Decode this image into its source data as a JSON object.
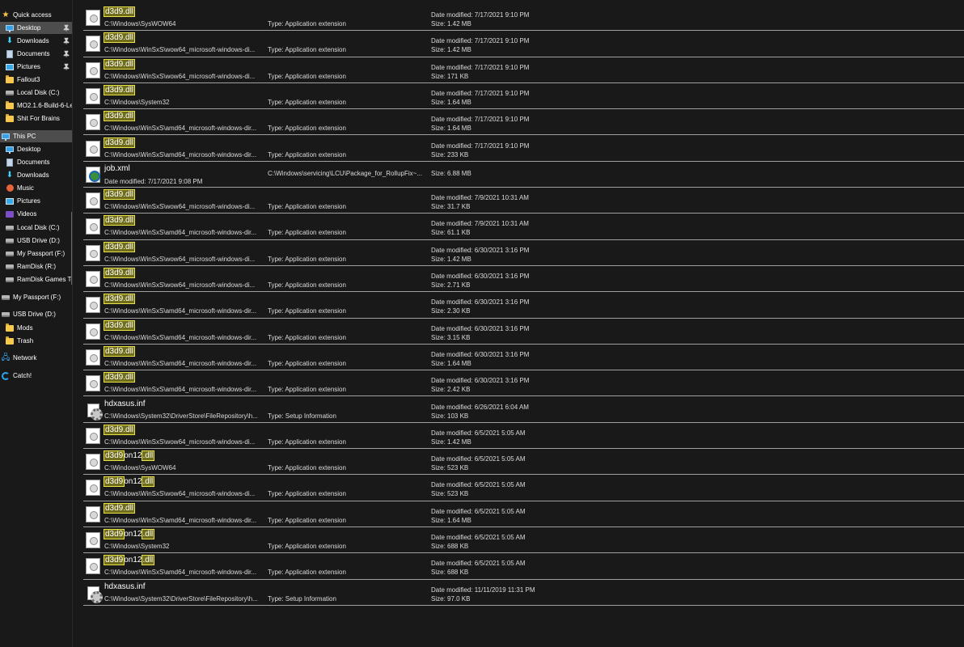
{
  "colors": {
    "background": "#191919",
    "selected": "#4d4d4d",
    "highlight_bg": "#706d1a",
    "highlight_border": "#e9e24a",
    "divider": "#a0a0a0"
  },
  "sidebar": {
    "quick_access": "Quick access",
    "desktop_pinned": "Desktop",
    "downloads_pinned": "Downloads",
    "documents_pinned": "Documents",
    "pictures_pinned": "Pictures",
    "fallout3": "Fallout3",
    "local_disk_c_quick": "Local Disk (C:)",
    "mo2": "MO2.1.6-Build-6-Le",
    "shit_for_brains": "Shit For Brains",
    "this_pc": "This PC",
    "pc_desktop": "Desktop",
    "pc_documents": "Documents",
    "pc_downloads": "Downloads",
    "pc_music": "Music",
    "pc_pictures": "Pictures",
    "pc_videos": "Videos",
    "pc_local_disk_c": "Local Disk (C:)",
    "pc_usb_drive_d": "USB Drive (D:)",
    "pc_my_passport_f": "My Passport (F:)",
    "pc_ramdisk_r": "RamDisk (R:)",
    "pc_ramdisk_games": "RamDisk Games To",
    "my_passport_f": "My Passport (F:)",
    "usb_drive_d": "USB Drive (D:)",
    "mods": "Mods",
    "trash": "Trash",
    "network": "Network",
    "catch": "Catch!"
  },
  "labels": {
    "type_prefix": "Type:",
    "date_prefix": "Date modified:",
    "size_prefix": "Size:"
  },
  "results": [
    {
      "pre": "",
      "hl1": "d3d9.dll",
      "mid": "",
      "hl2": "",
      "post": "",
      "path": "C:\\Windows\\SysWOW64",
      "type": "Type: Application extension",
      "date": "Date modified: 7/17/2021 9:10 PM",
      "size": "Size: 1.42 MB",
      "icon": "dll"
    },
    {
      "pre": "",
      "hl1": "d3d9.dll",
      "mid": "",
      "hl2": "",
      "post": "",
      "path": "C:\\Windows\\WinSxS\\wow64_microsoft-windows-di...",
      "type": "Type: Application extension",
      "date": "Date modified: 7/17/2021 9:10 PM",
      "size": "Size: 1.42 MB",
      "icon": "dll"
    },
    {
      "pre": "",
      "hl1": "d3d9.dll",
      "mid": "",
      "hl2": "",
      "post": "",
      "path": "C:\\Windows\\WinSxS\\wow64_microsoft-windows-di...",
      "type": "Type: Application extension",
      "date": "Date modified: 7/17/2021 9:10 PM",
      "size": "Size: 171 KB",
      "icon": "dll"
    },
    {
      "pre": "",
      "hl1": "d3d9.dll",
      "mid": "",
      "hl2": "",
      "post": "",
      "path": "C:\\Windows\\System32",
      "type": "Type: Application extension",
      "date": "Date modified: 7/17/2021 9:10 PM",
      "size": "Size: 1.64 MB",
      "icon": "dll"
    },
    {
      "pre": "",
      "hl1": "d3d9.dll",
      "mid": "",
      "hl2": "",
      "post": "",
      "path": "C:\\Windows\\WinSxS\\amd64_microsoft-windows-dir...",
      "type": "Type: Application extension",
      "date": "Date modified: 7/17/2021 9:10 PM",
      "size": "Size: 1.64 MB",
      "icon": "dll"
    },
    {
      "pre": "",
      "hl1": "d3d9.dll",
      "mid": "",
      "hl2": "",
      "post": "",
      "path": "C:\\Windows\\WinSxS\\amd64_microsoft-windows-dir...",
      "type": "Type: Application extension",
      "date": "Date modified: 7/17/2021 9:10 PM",
      "size": "Size: 233 KB",
      "icon": "dll"
    },
    {
      "pre": "job.xml",
      "hl1": "",
      "mid": "",
      "hl2": "",
      "post": "",
      "path": "",
      "under_date": "Date modified: 7/17/2021 9:08 PM",
      "type": "C:\\Windows\\servicing\\LCU\\Package_for_RollupFix~...",
      "date": "",
      "size": "Size: 6.88 MB",
      "icon": "xml",
      "layout": "mid"
    },
    {
      "pre": "",
      "hl1": "d3d9.dll",
      "mid": "",
      "hl2": "",
      "post": "",
      "path": "C:\\Windows\\WinSxS\\wow64_microsoft-windows-di...",
      "type": "Type: Application extension",
      "date": "Date modified: 7/9/2021 10:31 AM",
      "size": "Size: 31.7 KB",
      "icon": "dll"
    },
    {
      "pre": "",
      "hl1": "d3d9.dll",
      "mid": "",
      "hl2": "",
      "post": "",
      "path": "C:\\Windows\\WinSxS\\amd64_microsoft-windows-dir...",
      "type": "Type: Application extension",
      "date": "Date modified: 7/9/2021 10:31 AM",
      "size": "Size: 61.1 KB",
      "icon": "dll"
    },
    {
      "pre": "",
      "hl1": "d3d9.dll",
      "mid": "",
      "hl2": "",
      "post": "",
      "path": "C:\\Windows\\WinSxS\\wow64_microsoft-windows-di...",
      "type": "Type: Application extension",
      "date": "Date modified: 6/30/2021 3:16 PM",
      "size": "Size: 1.42 MB",
      "icon": "dll"
    },
    {
      "pre": "",
      "hl1": "d3d9.dll",
      "mid": "",
      "hl2": "",
      "post": "",
      "path": "C:\\Windows\\WinSxS\\wow64_microsoft-windows-di...",
      "type": "Type: Application extension",
      "date": "Date modified: 6/30/2021 3:16 PM",
      "size": "Size: 2.71 KB",
      "icon": "dll"
    },
    {
      "pre": "",
      "hl1": "d3d9.dll",
      "mid": "",
      "hl2": "",
      "post": "",
      "path": "C:\\Windows\\WinSxS\\amd64_microsoft-windows-dir...",
      "type": "Type: Application extension",
      "date": "Date modified: 6/30/2021 3:16 PM",
      "size": "Size: 2.30 KB",
      "icon": "dll"
    },
    {
      "pre": "",
      "hl1": "d3d9.dll",
      "mid": "",
      "hl2": "",
      "post": "",
      "path": "C:\\Windows\\WinSxS\\amd64_microsoft-windows-dir...",
      "type": "Type: Application extension",
      "date": "Date modified: 6/30/2021 3:16 PM",
      "size": "Size: 3.15 KB",
      "icon": "dll"
    },
    {
      "pre": "",
      "hl1": "d3d9.dll",
      "mid": "",
      "hl2": "",
      "post": "",
      "path": "C:\\Windows\\WinSxS\\amd64_microsoft-windows-dir...",
      "type": "Type: Application extension",
      "date": "Date modified: 6/30/2021 3:16 PM",
      "size": "Size: 1.64 MB",
      "icon": "dll"
    },
    {
      "pre": "",
      "hl1": "d3d9.dll",
      "mid": "",
      "hl2": "",
      "post": "",
      "path": "C:\\Windows\\WinSxS\\amd64_microsoft-windows-dir...",
      "type": "Type: Application extension",
      "date": "Date modified: 6/30/2021 3:16 PM",
      "size": "Size: 2.42 KB",
      "icon": "dll"
    },
    {
      "pre": "hdxasus.inf",
      "hl1": "",
      "mid": "",
      "hl2": "",
      "post": "",
      "path": "C:\\Windows\\System32\\DriverStore\\FileRepository\\h...",
      "type": "Type: Setup Information",
      "date": "Date modified: 6/26/2021 6:04 AM",
      "size": "Size: 103 KB",
      "icon": "inf"
    },
    {
      "pre": "",
      "hl1": "d3d9.dll",
      "mid": "",
      "hl2": "",
      "post": "",
      "path": "C:\\Windows\\WinSxS\\wow64_microsoft-windows-di...",
      "type": "Type: Application extension",
      "date": "Date modified: 6/5/2021 5:05 AM",
      "size": "Size: 1.42 MB",
      "icon": "dll"
    },
    {
      "pre": "",
      "hl1": "d3d9",
      "mid": "on12",
      "hl2": ".dll",
      "post": "",
      "path": "C:\\Windows\\SysWOW64",
      "type": "Type: Application extension",
      "date": "Date modified: 6/5/2021 5:05 AM",
      "size": "Size: 523 KB",
      "icon": "dll"
    },
    {
      "pre": "",
      "hl1": "d3d9",
      "mid": "on12",
      "hl2": ".dll",
      "post": "",
      "path": "C:\\Windows\\WinSxS\\wow64_microsoft-windows-di...",
      "type": "Type: Application extension",
      "date": "Date modified: 6/5/2021 5:05 AM",
      "size": "Size: 523 KB",
      "icon": "dll"
    },
    {
      "pre": "",
      "hl1": "d3d9.dll",
      "mid": "",
      "hl2": "",
      "post": "",
      "path": "C:\\Windows\\WinSxS\\amd64_microsoft-windows-dir...",
      "type": "Type: Application extension",
      "date": "Date modified: 6/5/2021 5:05 AM",
      "size": "Size: 1.64 MB",
      "icon": "dll"
    },
    {
      "pre": "",
      "hl1": "d3d9",
      "mid": "on12",
      "hl2": ".dll",
      "post": "",
      "path": "C:\\Windows\\System32",
      "type": "Type: Application extension",
      "date": "Date modified: 6/5/2021 5:05 AM",
      "size": "Size: 688 KB",
      "icon": "dll"
    },
    {
      "pre": "",
      "hl1": "d3d9",
      "mid": "on12",
      "hl2": ".dll",
      "post": "",
      "path": "C:\\Windows\\WinSxS\\amd64_microsoft-windows-dir...",
      "type": "Type: Application extension",
      "date": "Date modified: 6/5/2021 5:05 AM",
      "size": "Size: 688 KB",
      "icon": "dll"
    },
    {
      "pre": "hdxasus.inf",
      "hl1": "",
      "mid": "",
      "hl2": "",
      "post": "",
      "path": "C:\\Windows\\System32\\DriverStore\\FileRepository\\h...",
      "type": "Type: Setup Information",
      "date": "Date modified: 11/11/2019 11:31 PM",
      "size": "Size: 97.0 KB",
      "icon": "inf"
    }
  ]
}
